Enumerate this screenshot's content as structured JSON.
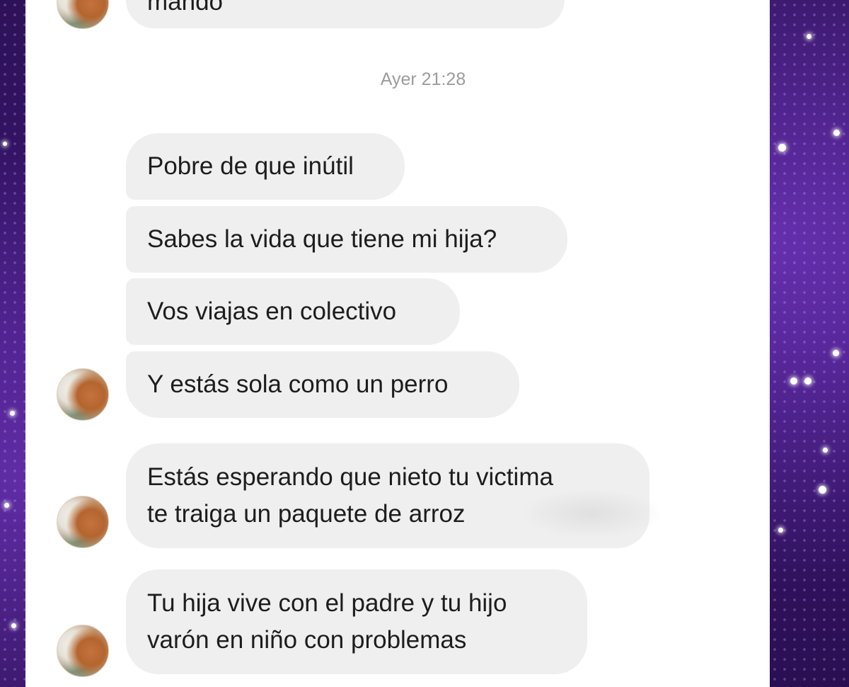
{
  "chat": {
    "timestamp": "Ayer 21:28",
    "previous_message_fragment": "mando",
    "messages": [
      {
        "lines": [
          "Pobre de que inútil"
        ]
      },
      {
        "lines": [
          "Sabes la vida que tiene mi hija?"
        ]
      },
      {
        "lines": [
          "Vos viajas en colectivo"
        ]
      },
      {
        "lines": [
          "Y estás sola como un perro"
        ]
      },
      {
        "lines": [
          "Estás esperando que nieto tu victima",
          "te traiga un paquete de arroz"
        ]
      },
      {
        "lines": [
          "Tu hija vive con el padre y tu hijo",
          "varón en niño con problemas"
        ]
      }
    ]
  },
  "colors": {
    "bubble_background": "#efefef",
    "panel_background": "#ffffff",
    "backdrop_purple": "#3a1670",
    "timestamp_gray": "#9c9c9c"
  }
}
